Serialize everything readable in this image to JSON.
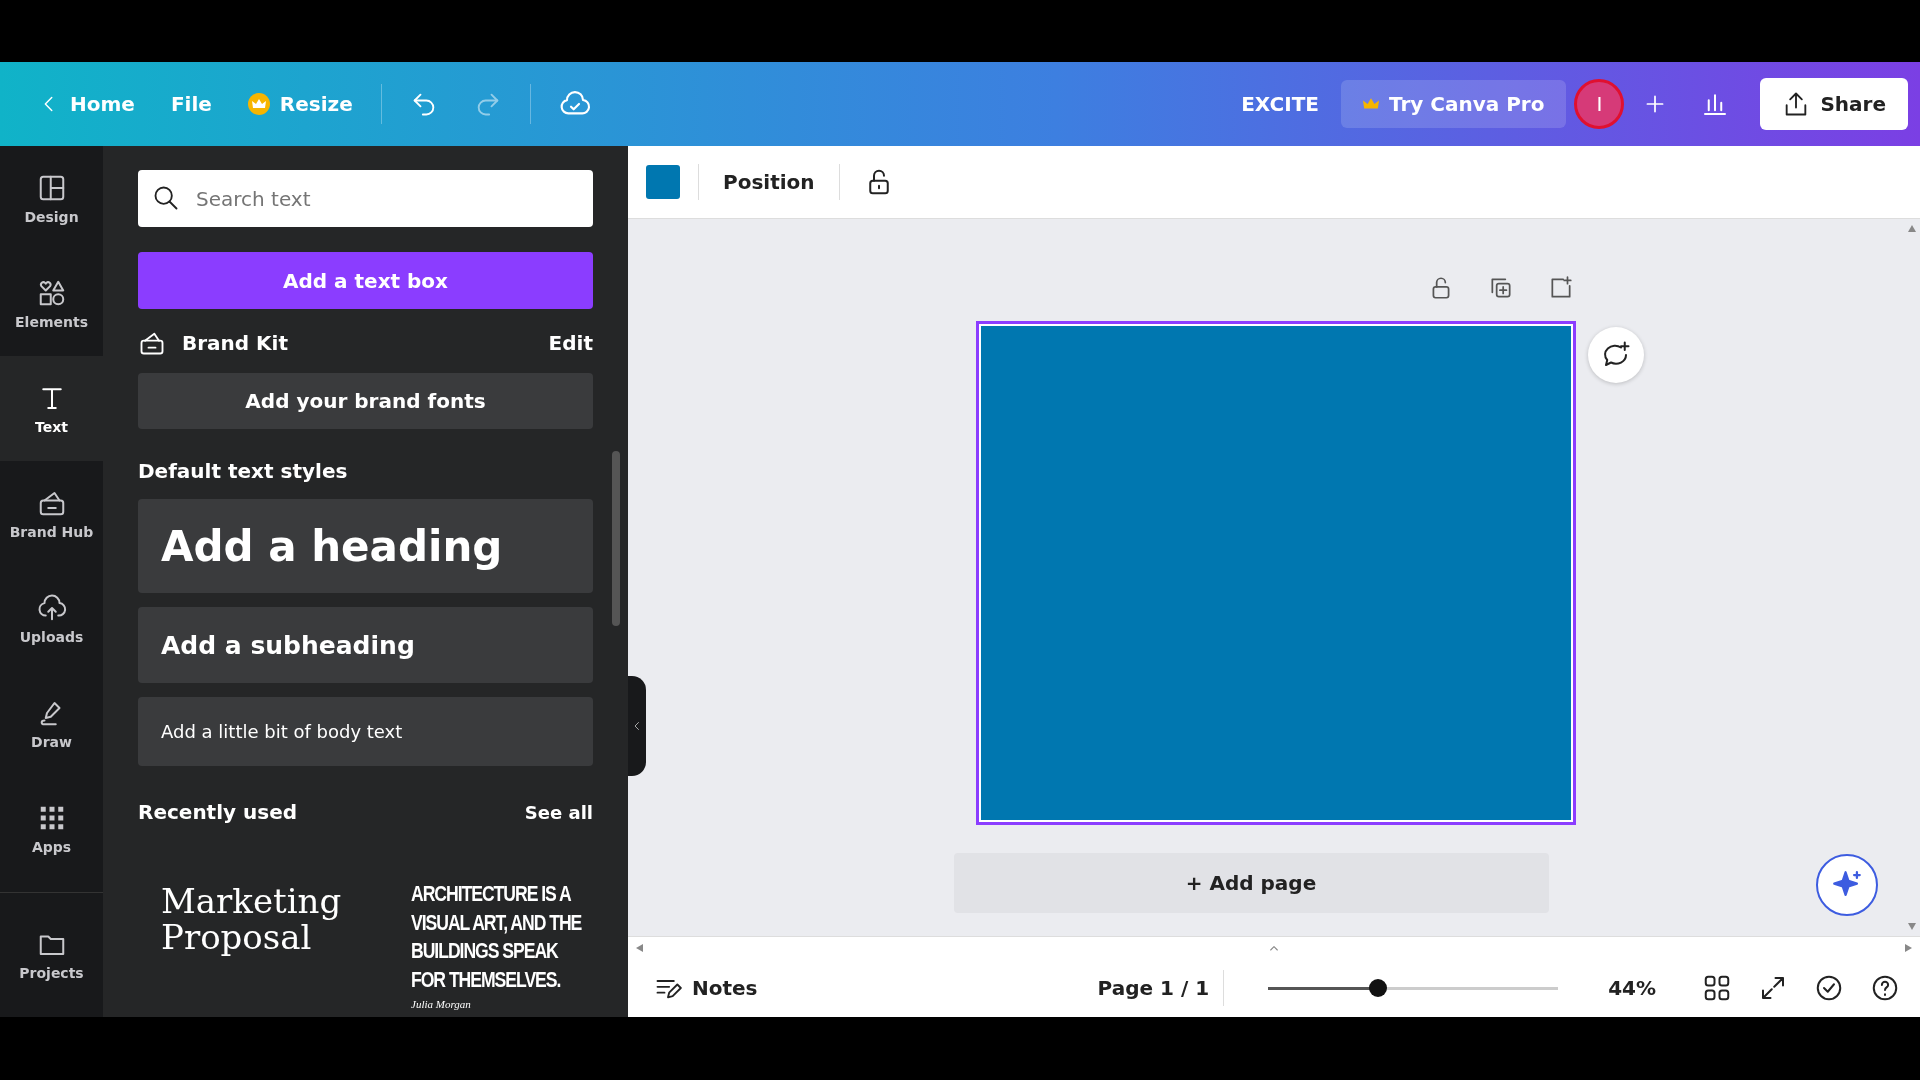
{
  "top_bar": {
    "back_label": "Home",
    "menu": [
      "File"
    ],
    "resize": "Resize",
    "project": "EXCITE",
    "pro": "Try Canva Pro",
    "avatar": "I",
    "share": "Share"
  },
  "rail": [
    {
      "label": "Design",
      "selected": false
    },
    {
      "label": "Elements",
      "selected": false
    },
    {
      "label": "Text",
      "selected": true
    },
    {
      "label": "Brand Hub",
      "selected": false
    },
    {
      "label": "Uploads",
      "selected": false
    },
    {
      "label": "Draw",
      "selected": false
    },
    {
      "label": "Apps",
      "selected": false
    },
    {
      "label": "Projects",
      "selected": false
    }
  ],
  "panel": {
    "search": {
      "placeholder": "Search text"
    },
    "add_button": "Add a text box",
    "brand_kit": {
      "title": "Brand Kit",
      "action": "Edit",
      "button": "Add your brand fonts"
    },
    "styles_title": "Default text styles",
    "styles": [
      {
        "kind": "heading",
        "text": "Add a heading"
      },
      {
        "kind": "subheading",
        "text": "Add a subheading"
      },
      {
        "kind": "body",
        "text": "Add a little bit of body text"
      }
    ],
    "recent": {
      "title": "Recently used",
      "action": "See all",
      "items": [
        {
          "kind": "serif",
          "title": "Marketing Proposal"
        },
        {
          "kind": "condensed",
          "title": "ARCHITECTURE IS A VISUAL ART, AND THE BUILDINGS SPEAK FOR THEMSELVES.",
          "author": "Julia Morgan"
        }
      ]
    }
  },
  "toolbar": {
    "color": "#0077b0",
    "position": "Position"
  },
  "page": {
    "color": "#0077b0",
    "add_page": "+ Add page"
  },
  "status_bar": {
    "notes": "Notes",
    "page": "Page 1 / 1",
    "zoom": {
      "level": 0.38
    },
    "zoom_text": "44%"
  }
}
